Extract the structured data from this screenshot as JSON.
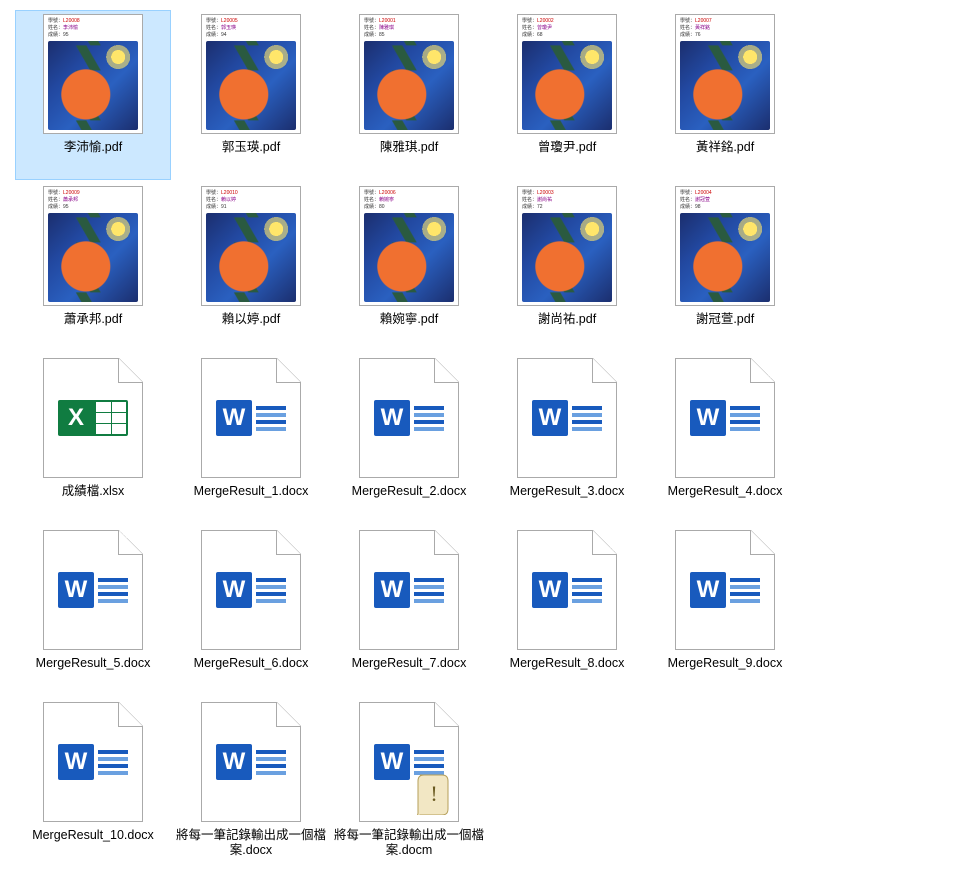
{
  "files": [
    {
      "name": "李沛愉.pdf",
      "kind": "pdf",
      "selected": true,
      "meta_id": "L20008",
      "meta_name": "李沛愉",
      "meta_grade": "95"
    },
    {
      "name": "郭玉瑛.pdf",
      "kind": "pdf",
      "selected": false,
      "meta_id": "L20005",
      "meta_name": "郭玉瑛",
      "meta_grade": "94"
    },
    {
      "name": "陳雅琪.pdf",
      "kind": "pdf",
      "selected": false,
      "meta_id": "L20001",
      "meta_name": "陳雅琪",
      "meta_grade": "85"
    },
    {
      "name": "曾瓊尹.pdf",
      "kind": "pdf",
      "selected": false,
      "meta_id": "L20002",
      "meta_name": "曾瓊尹",
      "meta_grade": "68"
    },
    {
      "name": "黃祥銘.pdf",
      "kind": "pdf",
      "selected": false,
      "meta_id": "L20007",
      "meta_name": "黃祥銘",
      "meta_grade": "76"
    },
    {
      "name": "蕭承邦.pdf",
      "kind": "pdf",
      "selected": false,
      "meta_id": "L20009",
      "meta_name": "蕭承邦",
      "meta_grade": "95"
    },
    {
      "name": "賴以婷.pdf",
      "kind": "pdf",
      "selected": false,
      "meta_id": "L20010",
      "meta_name": "賴以婷",
      "meta_grade": "91"
    },
    {
      "name": "賴婉寧.pdf",
      "kind": "pdf",
      "selected": false,
      "meta_id": "L20006",
      "meta_name": "賴婉寧",
      "meta_grade": "80"
    },
    {
      "name": "謝尚祐.pdf",
      "kind": "pdf",
      "selected": false,
      "meta_id": "L20003",
      "meta_name": "謝尚祐",
      "meta_grade": "72"
    },
    {
      "name": "謝冠萱.pdf",
      "kind": "pdf",
      "selected": false,
      "meta_id": "L20004",
      "meta_name": "謝冠萱",
      "meta_grade": "98"
    },
    {
      "name": "成績檔.xlsx",
      "kind": "xlsx",
      "selected": false
    },
    {
      "name": "MergeResult_1.docx",
      "kind": "docx",
      "selected": false
    },
    {
      "name": "MergeResult_2.docx",
      "kind": "docx",
      "selected": false
    },
    {
      "name": "MergeResult_3.docx",
      "kind": "docx",
      "selected": false
    },
    {
      "name": "MergeResult_4.docx",
      "kind": "docx",
      "selected": false
    },
    {
      "name": "MergeResult_5.docx",
      "kind": "docx",
      "selected": false
    },
    {
      "name": "MergeResult_6.docx",
      "kind": "docx",
      "selected": false
    },
    {
      "name": "MergeResult_7.docx",
      "kind": "docx",
      "selected": false
    },
    {
      "name": "MergeResult_8.docx",
      "kind": "docx",
      "selected": false
    },
    {
      "name": "MergeResult_9.docx",
      "kind": "docx",
      "selected": false
    },
    {
      "name": "MergeResult_10.docx",
      "kind": "docx",
      "selected": false
    },
    {
      "name": "將每一筆記錄輸出成一個檔案.docx",
      "kind": "docx",
      "selected": false
    },
    {
      "name": "將每一筆記錄輸出成一個檔案.docm",
      "kind": "docm",
      "selected": false
    }
  ],
  "pdf_meta_labels": {
    "id": "學號：",
    "name": "姓名：",
    "grade": "成績："
  }
}
